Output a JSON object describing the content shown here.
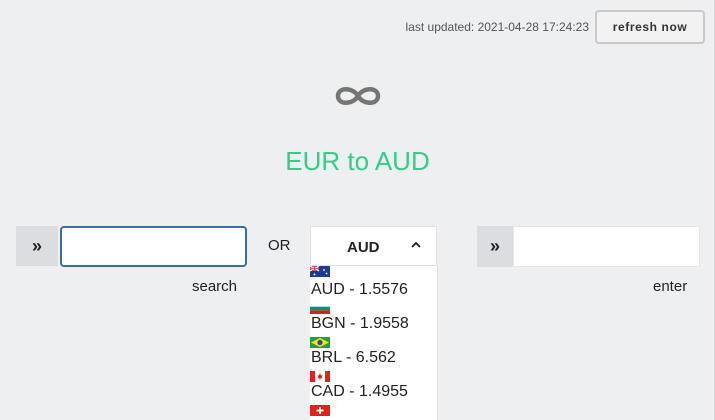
{
  "header": {
    "last_updated": "last updated: 2021-04-28 17:24:23",
    "refresh_label": "refresh now"
  },
  "logo": {
    "icon": "infinity-icon"
  },
  "title": "EUR to AUD",
  "search": {
    "prefix": "»",
    "value": "",
    "label": "search"
  },
  "or_label": "OR",
  "currency_select": {
    "selected": "AUD",
    "options": [
      {
        "flag": "australia-flag-icon",
        "label": "AUD - 1.5576"
      },
      {
        "flag": "bulgaria-flag-icon",
        "label": "BGN - 1.9558"
      },
      {
        "flag": "brazil-flag-icon",
        "label": "BRL - 6.562"
      },
      {
        "flag": "canada-flag-icon",
        "label": "CAD - 1.4955"
      },
      {
        "flag": "switzerland-flag-icon",
        "label": ""
      }
    ]
  },
  "amount": {
    "prefix": "»",
    "value": "",
    "label": "enter"
  },
  "colors": {
    "accent": "#35cc8a",
    "focus_border": "#3a6f9c",
    "background": "#eeeff1"
  }
}
